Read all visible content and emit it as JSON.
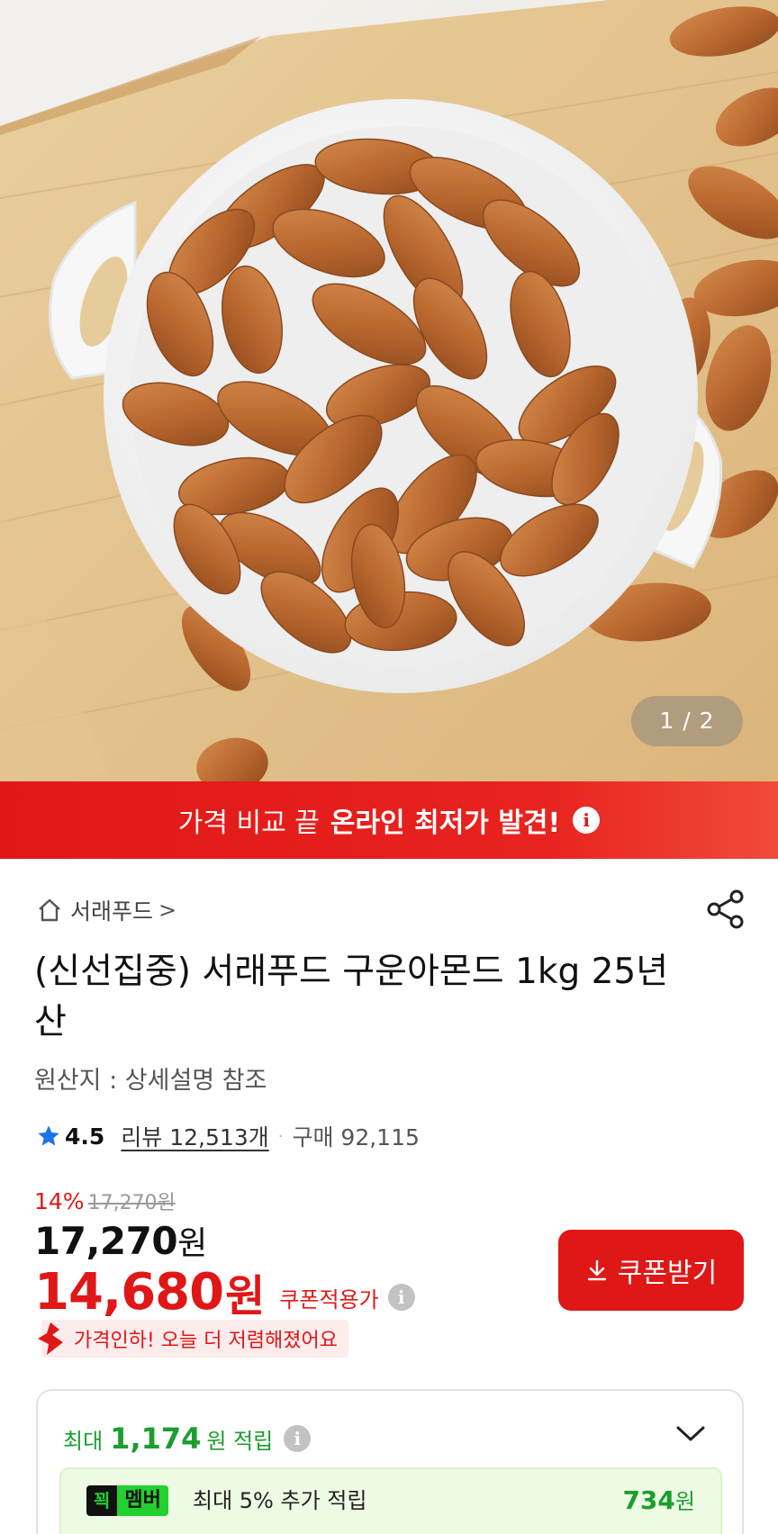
{
  "gallery": {
    "page_indicator": "1 / 2"
  },
  "promo": {
    "normal": "가격 비교 끝",
    "bold": "온라인 최저가 발견!",
    "info_glyph": "i"
  },
  "store": {
    "name": "서래푸드",
    "chevron": ">"
  },
  "product": {
    "title": "(신선집중) 서래푸드 구운아몬드 1kg 25년산",
    "origin": "원산지 : 상세설명 참조"
  },
  "rating": {
    "score": "4.5",
    "reviews": "리뷰 12,513개",
    "separator": "·",
    "purchases": "구매 92,115"
  },
  "pricing": {
    "discount_pct": "14%",
    "original_price": "17,270원",
    "price": "17,270",
    "price_unit": "원",
    "coupon_price": "14,680",
    "coupon_price_unit": "원",
    "coupon_label": "쿠폰적용가",
    "info_glyph": "i",
    "price_drop": "가격인하! 오늘 더 저렴해졌어요"
  },
  "coupon_button": {
    "label": "쿠폰받기"
  },
  "points": {
    "prefix": "최대",
    "amount": "1,174",
    "suffix": "원 적립",
    "info_glyph": "i",
    "member_badge_k": "꾁",
    "member_badge_m": "멤버",
    "member_desc": "최대 5% 추가 적립",
    "member_value": "734",
    "member_unit": "원"
  },
  "colors": {
    "accent_red": "#e01717",
    "green": "#1a9e2e",
    "member_bg": "#edfbe4",
    "member_badge": "#22d130"
  },
  "icons": [
    "home-icon",
    "share-icon",
    "star-icon",
    "download-icon",
    "price-drop-arrow-icon",
    "chevron-down-icon",
    "info-icon"
  ]
}
